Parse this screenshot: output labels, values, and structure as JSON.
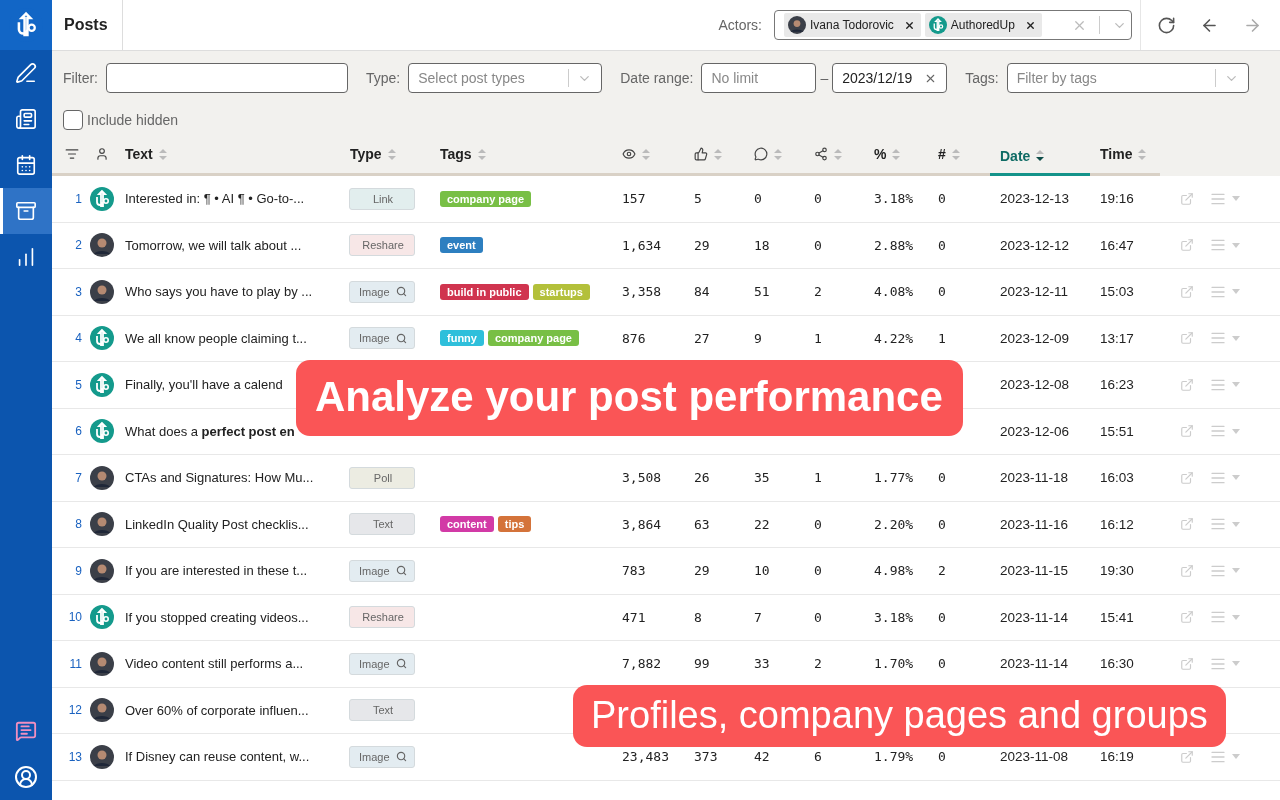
{
  "sidebar": {
    "items": [
      {
        "kind": "compose",
        "selected": false
      },
      {
        "kind": "planner",
        "selected": false
      },
      {
        "kind": "calendar",
        "selected": false
      },
      {
        "kind": "library",
        "selected": true
      },
      {
        "kind": "analytics",
        "selected": false
      }
    ],
    "bottom_items": [
      {
        "kind": "help"
      },
      {
        "kind": "profile"
      }
    ]
  },
  "header": {
    "title": "Posts",
    "actors_label": "Actors:",
    "actors": [
      {
        "name": "Ivana Todorovic",
        "kind": "person"
      },
      {
        "name": "AuthoredUp",
        "kind": "brand"
      }
    ],
    "nav_buttons": [
      {
        "kind": "refresh",
        "disabled": false
      },
      {
        "kind": "back",
        "disabled": false
      },
      {
        "kind": "forward",
        "disabled": true
      }
    ]
  },
  "filters": {
    "filter_label": "Filter:",
    "type_label": "Type:",
    "type_placeholder": "Select post types",
    "date_label": "Date range:",
    "date_from_placeholder": "No limit",
    "date_separator": "–",
    "date_to_value": "2023/12/19",
    "tags_label": "Tags:",
    "tags_placeholder": "Filter by tags",
    "include_hidden": {
      "label": "Include hidden",
      "checked": false
    }
  },
  "table": {
    "columns": [
      {
        "kind": "settings"
      },
      {
        "kind": "author"
      },
      {
        "kind": "text",
        "label": "Text",
        "sorted": false
      },
      {
        "kind": "type",
        "label": "Type",
        "sorted": false
      },
      {
        "kind": "tags",
        "label": "Tags",
        "sorted": false
      },
      {
        "kind": "views",
        "sorted": false
      },
      {
        "kind": "likes",
        "sorted": false
      },
      {
        "kind": "comments",
        "sorted": false
      },
      {
        "kind": "shares",
        "sorted": false
      },
      {
        "kind": "rate",
        "label": "%",
        "sorted": false
      },
      {
        "kind": "count",
        "label": "#",
        "sorted": false
      },
      {
        "kind": "date",
        "label": "Date",
        "sorted": true
      },
      {
        "kind": "time",
        "label": "Time",
        "sorted": false
      }
    ],
    "rows": [
      {
        "index": "1",
        "author": {
          "kind": "brand"
        },
        "text": "Interested in:  ¶ • AI ¶ • Go-to-...",
        "type": {
          "label": "Link",
          "kind": "link"
        },
        "tags": [
          {
            "label": "company page",
            "color": "#78bf45"
          }
        ],
        "stats": [
          "157",
          "5",
          "0",
          "0",
          "3.18%",
          "0"
        ],
        "date": "2023-12-13",
        "time": "19:16",
        "actions": true
      },
      {
        "index": "2",
        "author": {
          "kind": "person"
        },
        "text": "Tomorrow, we will talk about ...",
        "type": {
          "label": "Reshare",
          "kind": "reshare"
        },
        "tags": [
          {
            "label": "event",
            "color": "#2d7fc0"
          }
        ],
        "stats": [
          "1,634",
          "29",
          "18",
          "0",
          "2.88%",
          "0"
        ],
        "date": "2023-12-12",
        "time": "16:47",
        "actions": true
      },
      {
        "index": "3",
        "author": {
          "kind": "person"
        },
        "text": "Who says you have to play by ...",
        "type": {
          "label": "Image",
          "kind": "image"
        },
        "tags": [
          {
            "label": "build in public",
            "color": "#d0344f"
          },
          {
            "label": "startups",
            "color": "#b3c03a"
          }
        ],
        "stats": [
          "3,358",
          "84",
          "51",
          "2",
          "4.08%",
          "0"
        ],
        "date": "2023-12-11",
        "time": "15:03",
        "actions": true
      },
      {
        "index": "4",
        "author": {
          "kind": "brand"
        },
        "text": "We all know people claiming t...",
        "type": {
          "label": "Image",
          "kind": "image"
        },
        "tags": [
          {
            "label": "funny",
            "color": "#2ebfdb"
          },
          {
            "label": "company page",
            "color": "#78bf45"
          }
        ],
        "stats": [
          "876",
          "27",
          "9",
          "1",
          "4.22%",
          "1"
        ],
        "date": "2023-12-09",
        "time": "13:17",
        "actions": true
      },
      {
        "index": "5",
        "author": {
          "kind": "brand"
        },
        "text": "Finally, you'll have a calend",
        "date": "2023-12-08",
        "time": "16:23",
        "actions": true
      },
      {
        "index": "6",
        "author": {
          "kind": "brand"
        },
        "text": "What does a **perfect post en**",
        "date": "2023-12-06",
        "time": "15:51",
        "actions": true
      },
      {
        "index": "7",
        "author": {
          "kind": "person"
        },
        "text": "CTAs and Signatures: How Mu...",
        "type": {
          "label": "Poll",
          "kind": "poll"
        },
        "stats": [
          "3,508",
          "26",
          "35",
          "1",
          "1.77%",
          "0"
        ],
        "date": "2023-11-18",
        "time": "16:03",
        "actions": true
      },
      {
        "index": "8",
        "author": {
          "kind": "person"
        },
        "text": "LinkedIn Quality Post checklis...",
        "type": {
          "label": "Text",
          "kind": "text"
        },
        "tags": [
          {
            "label": "content",
            "color": "#d23aa6"
          },
          {
            "label": "tips",
            "color": "#d4733a"
          }
        ],
        "stats": [
          "3,864",
          "63",
          "22",
          "0",
          "2.20%",
          "0"
        ],
        "date": "2023-11-16",
        "time": "16:12",
        "actions": true
      },
      {
        "index": "9",
        "author": {
          "kind": "person"
        },
        "text": "If you are interested in these t...",
        "type": {
          "label": "Image",
          "kind": "image"
        },
        "stats": [
          "783",
          "29",
          "10",
          "0",
          "4.98%",
          "2"
        ],
        "date": "2023-11-15",
        "time": "19:30",
        "actions": true
      },
      {
        "index": "10",
        "author": {
          "kind": "brand"
        },
        "text": "If you stopped creating videos...",
        "type": {
          "label": "Reshare",
          "kind": "reshare"
        },
        "stats": [
          "471",
          "8",
          "7",
          "0",
          "3.18%",
          "0"
        ],
        "date": "2023-11-14",
        "time": "15:41",
        "actions": true
      },
      {
        "index": "11",
        "author": {
          "kind": "person"
        },
        "text": "Video content still performs a...",
        "type": {
          "label": "Image",
          "kind": "image"
        },
        "stats": [
          "7,882",
          "99",
          "33",
          "2",
          "1.70%",
          "0"
        ],
        "date": "2023-11-14",
        "time": "16:30",
        "actions": true
      },
      {
        "index": "12",
        "author": {
          "kind": "person"
        },
        "text": "Over 60% of corporate influen...",
        "type": {
          "label": "Text",
          "kind": "text"
        },
        "actions": false
      },
      {
        "index": "13",
        "author": {
          "kind": "person"
        },
        "text": "If Disney can reuse content, w...",
        "type": {
          "label": "Image",
          "kind": "image"
        },
        "stats": [
          "23,483",
          "373",
          "42",
          "6",
          "1.79%",
          "0"
        ],
        "date": "2023-11-08",
        "time": "16:19",
        "actions": true
      }
    ]
  },
  "banners": [
    {
      "text": "Analyze your post performance",
      "kind": "headline"
    },
    {
      "text": "Profiles, company pages and groups",
      "kind": "subline"
    }
  ]
}
